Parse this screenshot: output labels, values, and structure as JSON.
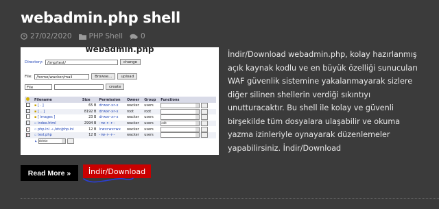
{
  "post": {
    "title": "webadmin.php shell",
    "date": "27/02/2020",
    "category": "PHP Shell",
    "comments": "0",
    "description": "İndir/Download webadmin.php, kolay hazırlanmış açık kaynak kodlu ve en büyük özelliği sunucuları WAF güvenlik sistemine yakalanmayarak sizlere diğer silinen shellerin verdiği sıkıntıyı unutturacaktır. Bu shell ile kolay ve güvenli birşekilde tüm dosyalara ulaşabilir ve okuma yazma izinleriyle oynayarak düzenlemeler yapabilirsiniz. İndir/Download",
    "read_more_label": "Read More »",
    "download_label": "İndir/Download"
  },
  "screenshot": {
    "title": "webadmin.php",
    "directory_label": "Directory:",
    "directory_value": "/tmp/test/",
    "change_label": "change",
    "file_label": "File:",
    "file_value": "/home/wacker/mail",
    "browse_label": "Browse...",
    "upload_label": "upload",
    "type_value": "File",
    "create_label": "create",
    "headers": [
      "",
      "Filename",
      "Size",
      "Permission",
      "Owner",
      "Group",
      "Functions"
    ],
    "rows": [
      {
        "name": "[ . ]",
        "size": "65 B",
        "perm": "drwxr-xr-x",
        "owner": "wacker",
        "group": "users",
        "func": ""
      },
      {
        "name": "[ .. ]",
        "size": "8192 B",
        "perm": "drwxr-xr-x",
        "owner": "root",
        "group": "root",
        "func": ""
      },
      {
        "name": "[ images ]",
        "size": "23 B",
        "perm": "drwxr-xr-x",
        "owner": "wacker",
        "group": "users",
        "func": ""
      },
      {
        "name": "index.html",
        "size": "2994 B",
        "perm": "-rw-r--r--",
        "owner": "wacker",
        "group": "users",
        "func": "edit"
      },
      {
        "name": "php.ini → /etc/php.ini",
        "size": "12 B",
        "perm": "lrwxrwxrwx",
        "owner": "wacker",
        "group": "users",
        "func": ""
      },
      {
        "name": "test.php",
        "size": "12 B",
        "perm": "-rw-r--r--",
        "owner": "wacker",
        "group": "users",
        "func": ""
      }
    ],
    "footer_select": "delete"
  },
  "colors": {
    "background": "#3b3b3b",
    "download_button": "#c90000",
    "read_more_button": "#000000"
  }
}
